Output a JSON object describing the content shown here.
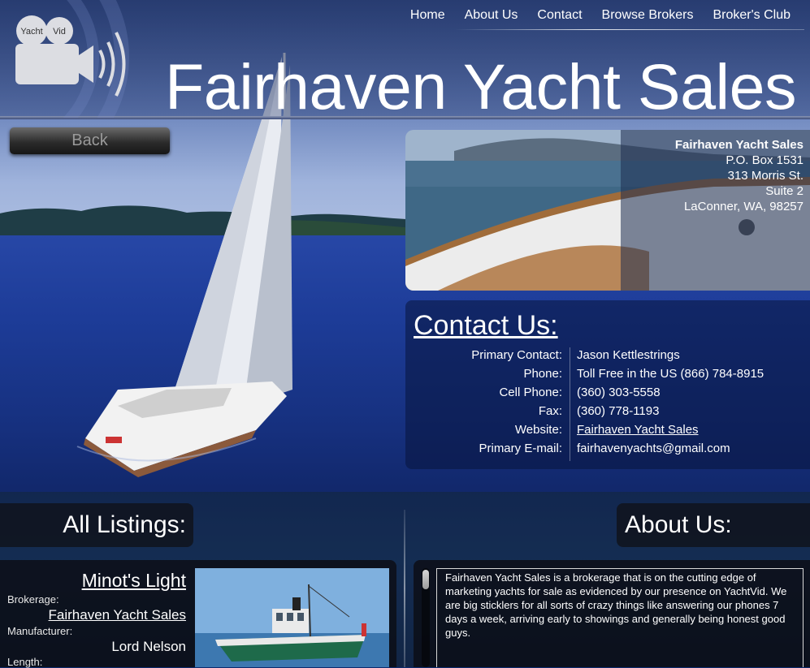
{
  "nav": {
    "items": [
      "Home",
      "About Us",
      "Contact",
      "Browse Brokers",
      "Broker's Club"
    ]
  },
  "logo": {
    "word1": "Yacht",
    "word2": "Vid"
  },
  "header": {
    "title": "Fairhaven Yacht Sales"
  },
  "back_button": {
    "label": "Back"
  },
  "address": {
    "name": "Fairhaven Yacht Sales",
    "line1": "P.O. Box 1531",
    "line2": "313 Morris St.",
    "line3": "Suite 2",
    "line4": "LaConner, WA, 98257"
  },
  "contact": {
    "heading": "Contact Us:",
    "rows": [
      {
        "label": "Primary Contact:",
        "value": "Jason Kettlestrings"
      },
      {
        "label": "Phone:",
        "value": "Toll Free in the US (866) 784-8915"
      },
      {
        "label": "Cell Phone:",
        "value": "(360) 303-5558"
      },
      {
        "label": "Fax:",
        "value": "(360) 778-1193"
      },
      {
        "label": "Website:",
        "value": "Fairhaven Yacht Sales"
      },
      {
        "label": "Primary E-mail:",
        "value": "fairhavenyachts@gmail.com"
      }
    ]
  },
  "listings": {
    "heading": "All Listings:",
    "items": [
      {
        "title": "Minot's Light",
        "brokerage_label": "Brokerage:",
        "brokerage": "Fairhaven Yacht Sales",
        "manufacturer_label": "Manufacturer:",
        "manufacturer": "Lord Nelson",
        "length_label": "Length:"
      }
    ]
  },
  "about": {
    "heading": "About Us:",
    "text": "Fairhaven Yacht Sales is a brokerage that is on the cutting edge of marketing yachts for sale as evidenced by our presence on YachtVid. We are big sticklers for all sorts of crazy things like answering our phones 7 days a week, arriving early to showings and generally being honest good guys."
  }
}
